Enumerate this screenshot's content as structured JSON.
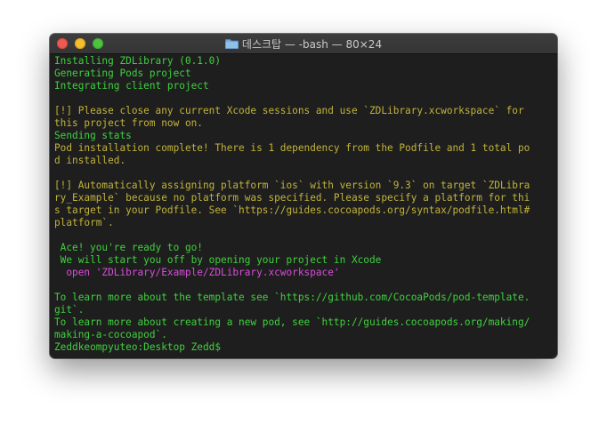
{
  "window": {
    "title": "데스크탑 — -bash — 80×24",
    "folder_icon": "folder-icon",
    "controls": [
      "close-button",
      "minimize-button",
      "zoom-button"
    ]
  },
  "colors": {
    "terminal_bg": "#1e1e1e",
    "green": "#3fd13f",
    "yellow": "#c2b33a",
    "magenta": "#d74ed8"
  },
  "terminal": {
    "lines": [
      {
        "text": "Installing ZDLibrary (0.1.0)",
        "color": "green"
      },
      {
        "text": "Generating Pods project",
        "color": "green"
      },
      {
        "text": "Integrating client project",
        "color": "green"
      },
      {
        "text": "",
        "color": "green"
      },
      {
        "text": "[!] Please close any current Xcode sessions and use `ZDLibrary.xcworkspace` for",
        "color": "yellow"
      },
      {
        "text": "this project from now on.",
        "color": "yellow"
      },
      {
        "text": "Sending stats",
        "color": "green"
      },
      {
        "text": "Pod installation complete! There is 1 dependency from the Podfile and 1 total po",
        "color": "yellow"
      },
      {
        "text": "d installed.",
        "color": "yellow"
      },
      {
        "text": "",
        "color": "green"
      },
      {
        "text": "[!] Automatically assigning platform `ios` with version `9.3` on target `ZDLibra",
        "color": "yellow"
      },
      {
        "text": "ry_Example` because no platform was specified. Please specify a platform for thi",
        "color": "yellow"
      },
      {
        "text": "s target in your Podfile. See `https://guides.cocoapods.org/syntax/podfile.html#",
        "color": "yellow"
      },
      {
        "text": "platform`.",
        "color": "yellow"
      },
      {
        "text": "",
        "color": "green"
      },
      {
        "text": " Ace! you're ready to go!",
        "color": "green"
      },
      {
        "text": " We will start you off by opening your project in Xcode",
        "color": "green"
      },
      {
        "text": "  open 'ZDLibrary/Example/ZDLibrary.xcworkspace'",
        "color": "magenta"
      },
      {
        "text": "",
        "color": "green"
      },
      {
        "text": "To learn more about the template see `https://github.com/CocoaPods/pod-template.",
        "color": "green"
      },
      {
        "text": "git`.",
        "color": "green"
      },
      {
        "text": "To learn more about creating a new pod, see `http://guides.cocoapods.org/making/",
        "color": "green"
      },
      {
        "text": "making-a-cocoapod`.",
        "color": "green"
      },
      {
        "text": "Zeddkeompyuteo:Desktop Zedd$ ",
        "color": "green"
      }
    ]
  }
}
